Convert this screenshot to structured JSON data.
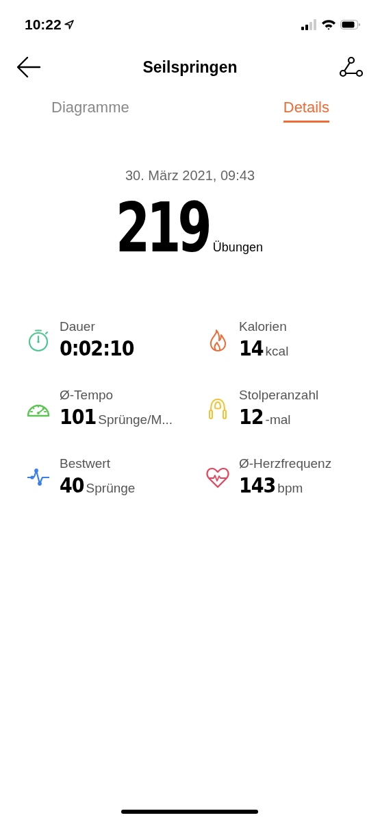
{
  "status_bar": {
    "time": "10:22"
  },
  "header": {
    "title": "Seilspringen"
  },
  "tabs": [
    {
      "label": "Diagramme",
      "selected": false
    },
    {
      "label": "Details",
      "selected": true
    }
  ],
  "summary": {
    "date": "30. März 2021, 09:43",
    "value": "219",
    "unit": "Übungen"
  },
  "stats": [
    {
      "kind": "stopwatch",
      "color": "#4cc98f",
      "label": "Dauer",
      "value": "0:02:10"
    },
    {
      "kind": "flame",
      "color": "#ee6b35",
      "label": "Kalorien",
      "value": "14",
      "unit": "kcal"
    },
    {
      "kind": "gauge",
      "color": "#5cc453",
      "label": "Ø-Tempo",
      "value": "101",
      "unit": "Sprünge/M..."
    },
    {
      "kind": "rope",
      "color": "#f2c230",
      "label": "Stolperanzahl",
      "value": "12",
      "unit": "-mal"
    },
    {
      "kind": "pulse",
      "color": "#3a7df0",
      "label": "Bestwert",
      "value": "40",
      "unit": "Sprünge"
    },
    {
      "kind": "heart",
      "color": "#e9435a",
      "label": "Ø-Herzfrequenz",
      "value": "143",
      "unit": "bpm"
    }
  ]
}
